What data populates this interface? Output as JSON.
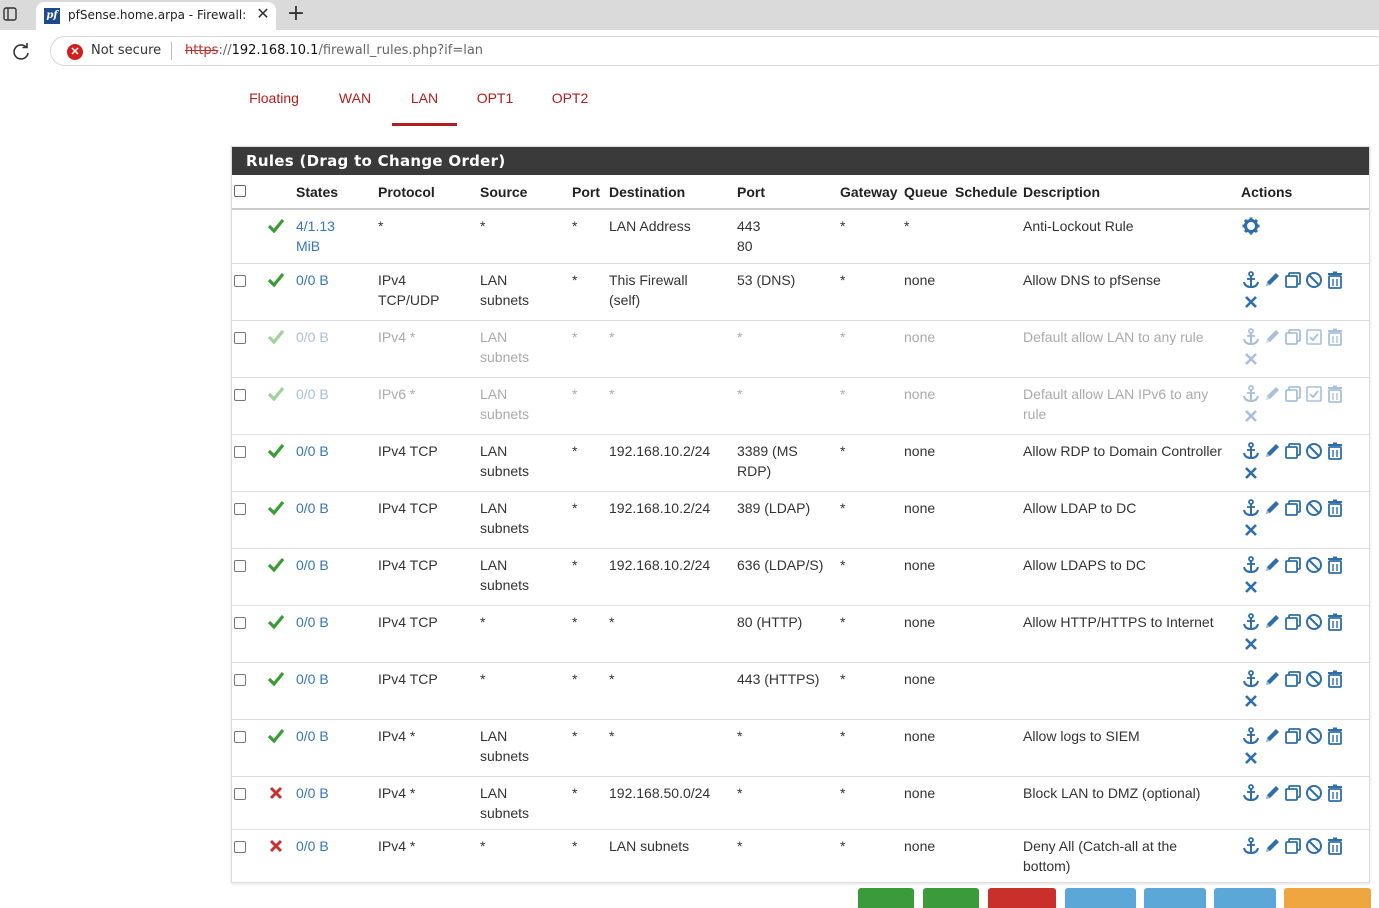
{
  "browser": {
    "tab_title": "pfSense.home.arpa - Firewall: Rul",
    "tab_icon": "pfsense-icon",
    "favicon_text": "pf",
    "security_label": "Not secure",
    "url_scheme": "https",
    "url_rest_host": "192.168.10.1",
    "url_path": "/firewall_rules.php?if=lan"
  },
  "nav": {
    "tabs": [
      {
        "label": "Floating"
      },
      {
        "label": "WAN"
      },
      {
        "label": "LAN",
        "active": true
      },
      {
        "label": "OPT1"
      },
      {
        "label": "OPT2"
      }
    ]
  },
  "panel": {
    "heading": "Rules (Drag to Change Order)"
  },
  "table": {
    "headers": {
      "states": "States",
      "protocol": "Protocol",
      "source": "Source",
      "port": "Port",
      "destination": "Destination",
      "dport": "Port",
      "gateway": "Gateway",
      "queue": "Queue",
      "schedule": "Schedule",
      "description": "Description",
      "actions": "Actions"
    },
    "rows": [
      {
        "checkbox": false,
        "status": "pass",
        "states1": "4/1.13",
        "states2": "MiB",
        "proto1": "*",
        "proto2": "",
        "src1": "*",
        "src2": "",
        "sport": "*",
        "dst1": "LAN Address",
        "dst2": "",
        "dport1": "443",
        "dport2": "80",
        "gateway": "*",
        "queue": "*",
        "schedule": "",
        "desc1": "Anti-Lockout Rule",
        "desc2": "",
        "actions": "gear",
        "disabled": false
      },
      {
        "checkbox": true,
        "status": "pass",
        "states1": "0/0 B",
        "states2": "",
        "proto1": "IPv4",
        "proto2": "TCP/UDP",
        "src1": "LAN",
        "src2": "subnets",
        "sport": "*",
        "dst1": "This Firewall",
        "dst2": "(self)",
        "dport1": "53 (DNS)",
        "dport2": "",
        "gateway": "*",
        "queue": "none",
        "schedule": "",
        "desc1": "Allow DNS to pfSense",
        "desc2": "",
        "actions": "full",
        "disabled": false
      },
      {
        "checkbox": true,
        "status": "pass",
        "states1": "0/0 B",
        "states2": "",
        "proto1": "IPv4 *",
        "proto2": "",
        "src1": "LAN",
        "src2": "subnets",
        "sport": "*",
        "dst1": "*",
        "dst2": "",
        "dport1": "*",
        "dport2": "",
        "gateway": "*",
        "queue": "none",
        "schedule": "",
        "desc1": "Default allow LAN to any rule",
        "desc2": "",
        "actions": "full-enable",
        "disabled": true
      },
      {
        "checkbox": true,
        "status": "pass",
        "states1": "0/0 B",
        "states2": "",
        "proto1": "IPv6 *",
        "proto2": "",
        "src1": "LAN",
        "src2": "subnets",
        "sport": "*",
        "dst1": "*",
        "dst2": "",
        "dport1": "*",
        "dport2": "",
        "gateway": "*",
        "queue": "none",
        "schedule": "",
        "desc1": "Default allow LAN IPv6 to any",
        "desc2": "rule",
        "actions": "full-enable",
        "disabled": true
      },
      {
        "checkbox": true,
        "status": "pass",
        "states1": "0/0 B",
        "states2": "",
        "proto1": "IPv4 TCP",
        "proto2": "",
        "src1": "LAN",
        "src2": "subnets",
        "sport": "*",
        "dst1": "192.168.10.2/24",
        "dst2": "",
        "dport1": "3389 (MS",
        "dport2": "RDP)",
        "gateway": "*",
        "queue": "none",
        "schedule": "",
        "desc1": "Allow RDP to Domain Controller",
        "desc2": "",
        "actions": "full",
        "disabled": false
      },
      {
        "checkbox": true,
        "status": "pass",
        "states1": "0/0 B",
        "states2": "",
        "proto1": "IPv4 TCP",
        "proto2": "",
        "src1": "LAN",
        "src2": "subnets",
        "sport": "*",
        "dst1": "192.168.10.2/24",
        "dst2": "",
        "dport1": "389 (LDAP)",
        "dport2": "",
        "gateway": "*",
        "queue": "none",
        "schedule": "",
        "desc1": "Allow LDAP to DC",
        "desc2": "",
        "actions": "full",
        "disabled": false
      },
      {
        "checkbox": true,
        "status": "pass",
        "states1": "0/0 B",
        "states2": "",
        "proto1": "IPv4 TCP",
        "proto2": "",
        "src1": "LAN",
        "src2": "subnets",
        "sport": "*",
        "dst1": "192.168.10.2/24",
        "dst2": "",
        "dport1": "636 (LDAP/S)",
        "dport2": "",
        "gateway": "*",
        "queue": "none",
        "schedule": "",
        "desc1": "Allow LDAPS to DC",
        "desc2": "",
        "actions": "full",
        "disabled": false
      },
      {
        "checkbox": true,
        "status": "pass",
        "states1": "0/0 B",
        "states2": "",
        "proto1": "IPv4 TCP",
        "proto2": "",
        "src1": "*",
        "src2": "",
        "sport": "*",
        "dst1": "*",
        "dst2": "",
        "dport1": "80 (HTTP)",
        "dport2": "",
        "gateway": "*",
        "queue": "none",
        "schedule": "",
        "desc1": "Allow HTTP/HTTPS to Internet",
        "desc2": "",
        "actions": "full",
        "disabled": false
      },
      {
        "checkbox": true,
        "status": "pass",
        "states1": "0/0 B",
        "states2": "",
        "proto1": "IPv4 TCP",
        "proto2": "",
        "src1": "*",
        "src2": "",
        "sport": "*",
        "dst1": "*",
        "dst2": "",
        "dport1": "443 (HTTPS)",
        "dport2": "",
        "gateway": "*",
        "queue": "none",
        "schedule": "",
        "desc1": "",
        "desc2": "",
        "actions": "full",
        "disabled": false
      },
      {
        "checkbox": true,
        "status": "pass",
        "states1": "0/0 B",
        "states2": "",
        "proto1": "IPv4 *",
        "proto2": "",
        "src1": "LAN",
        "src2": "subnets",
        "sport": "*",
        "dst1": "*",
        "dst2": "",
        "dport1": "*",
        "dport2": "",
        "gateway": "*",
        "queue": "none",
        "schedule": "",
        "desc1": "Allow logs to SIEM",
        "desc2": "",
        "actions": "full",
        "disabled": false
      },
      {
        "checkbox": true,
        "status": "block",
        "states1": "0/0 B",
        "states2": "",
        "proto1": "IPv4 *",
        "proto2": "",
        "src1": "LAN",
        "src2": "subnets",
        "sport": "*",
        "dst1": "192.168.50.0/24",
        "dst2": "",
        "dport1": "*",
        "dport2": "",
        "gateway": "*",
        "queue": "none",
        "schedule": "",
        "desc1": "Block LAN to DMZ (optional)",
        "desc2": "",
        "actions": "short",
        "disabled": false
      },
      {
        "checkbox": true,
        "status": "block",
        "states1": "0/0 B",
        "states2": "",
        "proto1": "IPv4 *",
        "proto2": "",
        "src1": "*",
        "src2": "",
        "sport": "*",
        "dst1": "LAN subnets",
        "dst2": "",
        "dport1": "*",
        "dport2": "",
        "gateway": "*",
        "queue": "none",
        "schedule": "",
        "desc1": "Deny All (Catch-all at the",
        "desc2": "bottom)",
        "actions": "short",
        "disabled": false
      }
    ]
  },
  "colors": {
    "pass": "#3a9c35",
    "pass_disabled": "#9fd39b",
    "block": "#c9302c",
    "action": "#2f6ea8",
    "action_disabled": "#a9c0da",
    "nav_active": "#b31d1d",
    "heading_bg": "#3a3a3a"
  },
  "bottom_buttons": [
    {
      "color": "#3b9b3b"
    },
    {
      "color": "#3b9b3b"
    },
    {
      "color": "#c9302c"
    },
    {
      "color": "#5ba8d8"
    },
    {
      "color": "#5ba8d8"
    },
    {
      "color": "#5ba8d8"
    },
    {
      "color": "#f0a640"
    }
  ]
}
